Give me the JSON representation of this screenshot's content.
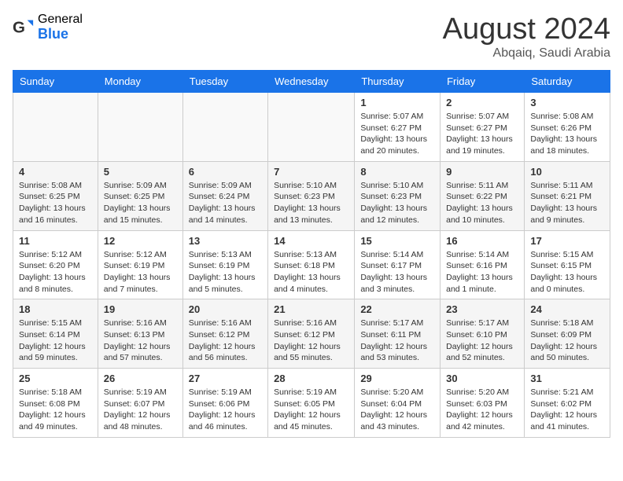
{
  "header": {
    "logo_general": "General",
    "logo_blue": "Blue",
    "month_title": "August 2024",
    "location": "Abqaiq, Saudi Arabia"
  },
  "days_of_week": [
    "Sunday",
    "Monday",
    "Tuesday",
    "Wednesday",
    "Thursday",
    "Friday",
    "Saturday"
  ],
  "weeks": [
    [
      {
        "day": "",
        "info": ""
      },
      {
        "day": "",
        "info": ""
      },
      {
        "day": "",
        "info": ""
      },
      {
        "day": "",
        "info": ""
      },
      {
        "day": "1",
        "info": "Sunrise: 5:07 AM\nSunset: 6:27 PM\nDaylight: 13 hours\nand 20 minutes."
      },
      {
        "day": "2",
        "info": "Sunrise: 5:07 AM\nSunset: 6:27 PM\nDaylight: 13 hours\nand 19 minutes."
      },
      {
        "day": "3",
        "info": "Sunrise: 5:08 AM\nSunset: 6:26 PM\nDaylight: 13 hours\nand 18 minutes."
      }
    ],
    [
      {
        "day": "4",
        "info": "Sunrise: 5:08 AM\nSunset: 6:25 PM\nDaylight: 13 hours\nand 16 minutes."
      },
      {
        "day": "5",
        "info": "Sunrise: 5:09 AM\nSunset: 6:25 PM\nDaylight: 13 hours\nand 15 minutes."
      },
      {
        "day": "6",
        "info": "Sunrise: 5:09 AM\nSunset: 6:24 PM\nDaylight: 13 hours\nand 14 minutes."
      },
      {
        "day": "7",
        "info": "Sunrise: 5:10 AM\nSunset: 6:23 PM\nDaylight: 13 hours\nand 13 minutes."
      },
      {
        "day": "8",
        "info": "Sunrise: 5:10 AM\nSunset: 6:23 PM\nDaylight: 13 hours\nand 12 minutes."
      },
      {
        "day": "9",
        "info": "Sunrise: 5:11 AM\nSunset: 6:22 PM\nDaylight: 13 hours\nand 10 minutes."
      },
      {
        "day": "10",
        "info": "Sunrise: 5:11 AM\nSunset: 6:21 PM\nDaylight: 13 hours\nand 9 minutes."
      }
    ],
    [
      {
        "day": "11",
        "info": "Sunrise: 5:12 AM\nSunset: 6:20 PM\nDaylight: 13 hours\nand 8 minutes."
      },
      {
        "day": "12",
        "info": "Sunrise: 5:12 AM\nSunset: 6:19 PM\nDaylight: 13 hours\nand 7 minutes."
      },
      {
        "day": "13",
        "info": "Sunrise: 5:13 AM\nSunset: 6:19 PM\nDaylight: 13 hours\nand 5 minutes."
      },
      {
        "day": "14",
        "info": "Sunrise: 5:13 AM\nSunset: 6:18 PM\nDaylight: 13 hours\nand 4 minutes."
      },
      {
        "day": "15",
        "info": "Sunrise: 5:14 AM\nSunset: 6:17 PM\nDaylight: 13 hours\nand 3 minutes."
      },
      {
        "day": "16",
        "info": "Sunrise: 5:14 AM\nSunset: 6:16 PM\nDaylight: 13 hours\nand 1 minute."
      },
      {
        "day": "17",
        "info": "Sunrise: 5:15 AM\nSunset: 6:15 PM\nDaylight: 13 hours\nand 0 minutes."
      }
    ],
    [
      {
        "day": "18",
        "info": "Sunrise: 5:15 AM\nSunset: 6:14 PM\nDaylight: 12 hours\nand 59 minutes."
      },
      {
        "day": "19",
        "info": "Sunrise: 5:16 AM\nSunset: 6:13 PM\nDaylight: 12 hours\nand 57 minutes."
      },
      {
        "day": "20",
        "info": "Sunrise: 5:16 AM\nSunset: 6:12 PM\nDaylight: 12 hours\nand 56 minutes."
      },
      {
        "day": "21",
        "info": "Sunrise: 5:16 AM\nSunset: 6:12 PM\nDaylight: 12 hours\nand 55 minutes."
      },
      {
        "day": "22",
        "info": "Sunrise: 5:17 AM\nSunset: 6:11 PM\nDaylight: 12 hours\nand 53 minutes."
      },
      {
        "day": "23",
        "info": "Sunrise: 5:17 AM\nSunset: 6:10 PM\nDaylight: 12 hours\nand 52 minutes."
      },
      {
        "day": "24",
        "info": "Sunrise: 5:18 AM\nSunset: 6:09 PM\nDaylight: 12 hours\nand 50 minutes."
      }
    ],
    [
      {
        "day": "25",
        "info": "Sunrise: 5:18 AM\nSunset: 6:08 PM\nDaylight: 12 hours\nand 49 minutes."
      },
      {
        "day": "26",
        "info": "Sunrise: 5:19 AM\nSunset: 6:07 PM\nDaylight: 12 hours\nand 48 minutes."
      },
      {
        "day": "27",
        "info": "Sunrise: 5:19 AM\nSunset: 6:06 PM\nDaylight: 12 hours\nand 46 minutes."
      },
      {
        "day": "28",
        "info": "Sunrise: 5:19 AM\nSunset: 6:05 PM\nDaylight: 12 hours\nand 45 minutes."
      },
      {
        "day": "29",
        "info": "Sunrise: 5:20 AM\nSunset: 6:04 PM\nDaylight: 12 hours\nand 43 minutes."
      },
      {
        "day": "30",
        "info": "Sunrise: 5:20 AM\nSunset: 6:03 PM\nDaylight: 12 hours\nand 42 minutes."
      },
      {
        "day": "31",
        "info": "Sunrise: 5:21 AM\nSunset: 6:02 PM\nDaylight: 12 hours\nand 41 minutes."
      }
    ]
  ]
}
